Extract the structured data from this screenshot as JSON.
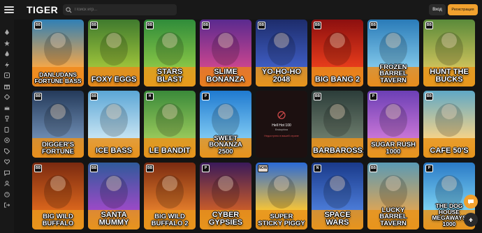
{
  "header": {
    "logo": "TIGER",
    "search_placeholder": "Поиск игр...",
    "login_label": "Вход",
    "register_label": "Регистрация"
  },
  "sidebar": {
    "icons": [
      "rocket-icon",
      "star-icon",
      "flame-icon",
      "bolt-icon",
      "dice-icon",
      "gift-icon",
      "diamond-icon",
      "crown-icon",
      "trophy-icon",
      "cards-icon",
      "chip-icon",
      "tag-icon",
      "heart-icon",
      "chat-icon",
      "user-icon",
      "help-icon",
      "logout-icon"
    ]
  },
  "games": [
    {
      "title": "DANLUDANS FORTUNE BASS",
      "badge": "BB",
      "bg1": "#2f7fb5",
      "bg2": "#f0a64c",
      "frame": "#f08a1c"
    },
    {
      "title": "FOXY EGGS",
      "badge": "BB",
      "bg1": "#3f7a2e",
      "bg2": "#9bc13a",
      "frame": "#e88b1c"
    },
    {
      "title": "STARS BLAST",
      "badge": "BB",
      "bg1": "#2f8c3a",
      "bg2": "#86c446",
      "frame": "#e89a1c"
    },
    {
      "title": "SLIME BONANZA",
      "badge": "BB",
      "bg1": "#5a2a8f",
      "bg2": "#c7448f",
      "frame": "#e77f1e"
    },
    {
      "title": "YO-HO-HO 2048",
      "badge": "BB",
      "bg1": "#1d2c6b",
      "bg2": "#3e5cc1",
      "frame": "#e8951c"
    },
    {
      "title": "BIG BANG 2",
      "badge": "BB",
      "bg1": "#8c0f0f",
      "bg2": "#e63b1b",
      "frame": "#e8891c"
    },
    {
      "title": "FROZEN BARREL TAVERN",
      "badge": "BB",
      "bg1": "#2a7bb8",
      "bg2": "#7ec5e8",
      "frame": "#e88c1c"
    },
    {
      "title": "HUNT THE BUCKS",
      "badge": "BB",
      "bg1": "#5a8a3a",
      "bg2": "#c9c05a",
      "frame": "#e8971c"
    },
    {
      "title": "DIGGER'S FORTUNE",
      "badge": "BB",
      "bg1": "#243a5a",
      "bg2": "#6c8ab0",
      "frame": "#e88f1c"
    },
    {
      "title": "ICE BASS",
      "badge": "BB",
      "bg1": "#5ba6d6",
      "bg2": "#c5e3f2",
      "frame": "#e8921c"
    },
    {
      "title": "LE BANDIT",
      "badge": "H",
      "bg1": "#3a8a3a",
      "bg2": "#96c75a",
      "frame": "#e8941c"
    },
    {
      "title": "SWEET BONANZA 2500",
      "badge": "P",
      "bg1": "#1f7ad0",
      "bg2": "#7cc7f2",
      "frame": "#e8931c"
    },
    {
      "title": "Hell Hot 100",
      "provider": "Endorphina",
      "notice": "Недоступно в вашей стране",
      "badge": "",
      "bg1": "#1c1010",
      "bg2": "#1c1010",
      "frame": "#1c1010"
    },
    {
      "title": "BARBAROSSA",
      "badge": "BB",
      "bg1": "#2c3d3a",
      "bg2": "#6a7a6a",
      "frame": "#e8921c"
    },
    {
      "title": "SUGAR RUSH 1000",
      "badge": "P",
      "bg1": "#6b3fb5",
      "bg2": "#c774d6",
      "frame": "#e8951c"
    },
    {
      "title": "CAFE 50'S",
      "badge": "BB",
      "bg1": "#5fa8c6",
      "bg2": "#f2d28a",
      "frame": "#e8941c"
    },
    {
      "title": "BIG WILD BUFFALO",
      "badge": "BB",
      "bg1": "#7a2a10",
      "bg2": "#d8641c",
      "frame": "#e8941c"
    },
    {
      "title": "SANTA MUMMY",
      "badge": "BB",
      "bg1": "#2f5a9a",
      "bg2": "#9a4ac6",
      "frame": "#e8941c"
    },
    {
      "title": "BIG WILD BUFFALO 2",
      "badge": "BB",
      "bg1": "#7a2a10",
      "bg2": "#e07a2a",
      "frame": "#e8941c"
    },
    {
      "title": "CYBER GYPSIES",
      "badge": "P",
      "bg1": "#3a1a5a",
      "bg2": "#c65a2a",
      "frame": "#e8941c"
    },
    {
      "title": "SUPER STICKY PIGGY",
      "badge": "NOW",
      "bg1": "#2a6ad6",
      "bg2": "#f2c23a",
      "frame": "#e8941c"
    },
    {
      "title": "SPACE WARS",
      "badge": "N",
      "bg1": "#1a3a8a",
      "bg2": "#4a7ad6",
      "frame": "#e8941c"
    },
    {
      "title": "LUCKY BARREL TAVERN",
      "badge": "BB",
      "bg1": "#5a9ab5",
      "bg2": "#d6a45a",
      "frame": "#e8941c"
    },
    {
      "title": "THE DOG HOUSE MEGAWAYS 1000",
      "badge": "P",
      "bg1": "#2a7ac6",
      "bg2": "#7ad0f2",
      "frame": "#e8941c"
    }
  ]
}
